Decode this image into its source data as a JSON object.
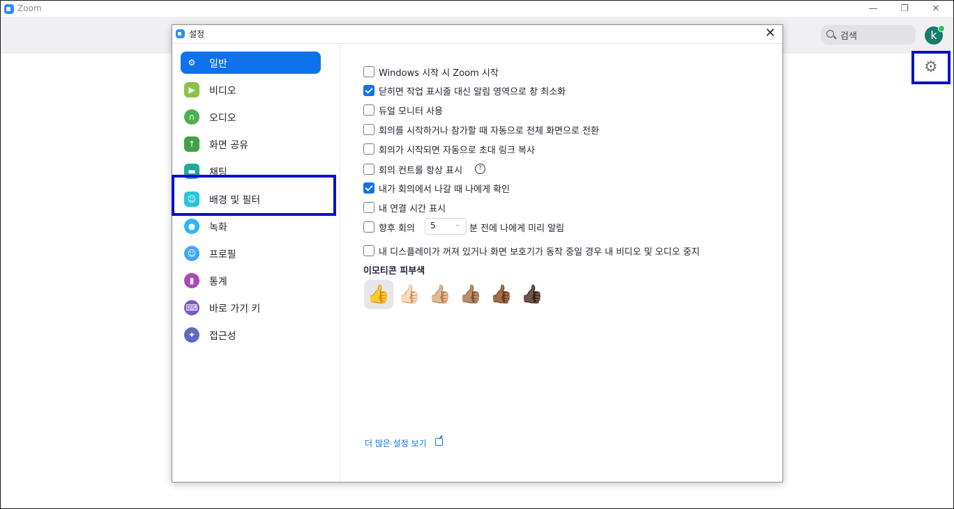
{
  "window": {
    "title": "Zoom",
    "minimize": "—",
    "restore": "❐",
    "close": "✕"
  },
  "header": {
    "search_label": "검색",
    "avatar_letter": "k",
    "settings_glyph": "⚙"
  },
  "dialog": {
    "title": "설정",
    "close": "✕",
    "nav": [
      {
        "label": "일반",
        "icon": "gear-icon",
        "color": "#0e72ed",
        "glyph": "⚙",
        "active": true
      },
      {
        "label": "비디오",
        "icon": "video-camera-icon",
        "color": "#8bc34a",
        "glyph": "▶"
      },
      {
        "label": "오디오",
        "icon": "headphones-icon",
        "color": "#4caf50",
        "glyph": "∩"
      },
      {
        "label": "화면 공유",
        "icon": "share-screen-icon",
        "color": "#43a047",
        "glyph": "↑"
      },
      {
        "label": "채팅",
        "icon": "chat-icon",
        "color": "#26a69a",
        "glyph": "▬"
      },
      {
        "label": "배경 및 필터",
        "icon": "background-icon",
        "color": "#26c6da",
        "glyph": "☺"
      },
      {
        "label": "녹화",
        "icon": "record-icon",
        "color": "#29b6f6",
        "glyph": "●"
      },
      {
        "label": "프로필",
        "icon": "profile-icon",
        "color": "#42a5f5",
        "glyph": "☺"
      },
      {
        "label": "통계",
        "icon": "statistics-icon",
        "color": "#ab47bc",
        "glyph": "▮"
      },
      {
        "label": "바로 가기 키",
        "icon": "keyboard-icon",
        "color": "#7e57c2",
        "glyph": "⌨"
      },
      {
        "label": "접근성",
        "icon": "accessibility-icon",
        "color": "#5c6bc0",
        "glyph": "✦"
      }
    ],
    "options": [
      {
        "label": "Windows 시작 시 Zoom 시작",
        "checked": false
      },
      {
        "label": "닫히면 작업 표시줄 대신 알림 영역으로 창 최소화",
        "checked": true
      },
      {
        "label": "듀얼 모니터 사용",
        "checked": false
      },
      {
        "label": "회의를 시작하거나 참가할 때 자동으로 전체 화면으로 전환",
        "checked": false
      },
      {
        "label": "회의가 시작되면 자동으로 초대 링크 복사",
        "checked": false
      },
      {
        "label": "회의 컨트롤 항상 표시",
        "checked": false
      },
      {
        "label": "내가 회의에서 나갈 때 나에게 확인",
        "checked": true
      },
      {
        "label": "내 연결 시간 표시",
        "checked": false
      },
      {
        "label": "향후 회의",
        "checked": false
      },
      {
        "label": "내 디스플레이가 꺼져 있거나 화면 보호기가 동작 중일 경우 내 비디오 및 오디오 중지",
        "checked": false
      }
    ],
    "help_glyph": "?",
    "reminder": {
      "minutes": "5",
      "suffix": "분 전에 나에게 미리 알림",
      "chevron": "⌄"
    },
    "emoji_section_title": "이모티콘 피부색",
    "thumbs": [
      "👍",
      "👍🏻",
      "👍🏼",
      "👍🏽",
      "👍🏾",
      "👍🏿"
    ],
    "more_settings_link": "더 많은 설정 보기"
  }
}
